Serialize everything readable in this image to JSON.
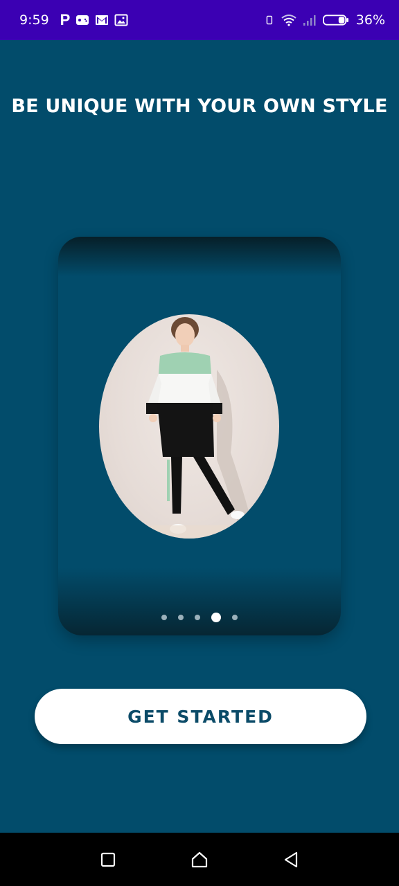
{
  "status_bar": {
    "time": "9:59",
    "app_letter": "P",
    "battery": "36%",
    "icons": [
      "game-controller-icon",
      "gmail-icon",
      "gallery-icon",
      "phone-icon",
      "wifi-icon",
      "signal-icon",
      "battery-icon"
    ],
    "background_color": "#3b00b3"
  },
  "onboarding": {
    "headline": "BE UNIQUE WITH YOUR OWN STYLE",
    "carousel": {
      "page_count": 5,
      "active_index": 3
    },
    "cta_label": "GET STARTED"
  },
  "nav_bar": {
    "icons": [
      "recent-apps-icon",
      "home-icon",
      "back-icon"
    ]
  },
  "colors": {
    "background": "#024c6b",
    "button_text": "#0b4b68",
    "dot_inactive": "#9bb1bb",
    "dot_active": "#ffffff"
  }
}
